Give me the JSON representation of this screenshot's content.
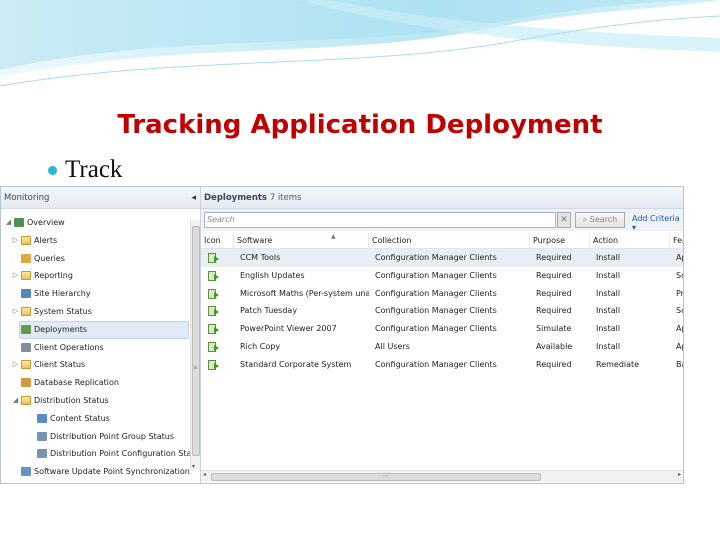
{
  "slide": {
    "title": "Tracking Application Deployment",
    "bullet": "Track"
  },
  "nav": {
    "header": "Monitoring",
    "collapse_glyph": "◂",
    "items": [
      {
        "label": "Overview",
        "icon": "overview-icon",
        "level": 0,
        "twisty": "◢"
      },
      {
        "label": "Alerts",
        "icon": "folder-icon",
        "level": 1,
        "twisty": "▷"
      },
      {
        "label": "Queries",
        "icon": "queries-icon",
        "level": 1,
        "twisty": ""
      },
      {
        "label": "Reporting",
        "icon": "folder-icon",
        "level": 1,
        "twisty": "▷"
      },
      {
        "label": "Site Hierarchy",
        "icon": "site-hierarchy-icon",
        "level": 1,
        "twisty": ""
      },
      {
        "label": "System Status",
        "icon": "folder-icon",
        "level": 1,
        "twisty": "▷"
      },
      {
        "label": "Deployments",
        "icon": "deployments-icon",
        "level": 1,
        "twisty": "",
        "selected": true
      },
      {
        "label": "Client Operations",
        "icon": "client-operations-icon",
        "level": 1,
        "twisty": ""
      },
      {
        "label": "Client Status",
        "icon": "folder-icon",
        "level": 1,
        "twisty": "▷"
      },
      {
        "label": "Database Replication",
        "icon": "database-replication-icon",
        "level": 1,
        "twisty": ""
      },
      {
        "label": "Distribution Status",
        "icon": "folder-icon",
        "level": 1,
        "twisty": "◢"
      },
      {
        "label": "Content Status",
        "icon": "content-status-icon",
        "level": 2,
        "twisty": ""
      },
      {
        "label": "Distribution Point Group Status",
        "icon": "dp-group-status-icon",
        "level": 2,
        "twisty": ""
      },
      {
        "label": "Distribution Point Configuration Status",
        "icon": "dp-config-status-icon",
        "level": 2,
        "twisty": ""
      },
      {
        "label": "Software Update Point Synchronization Sta",
        "icon": "sup-sync-icon",
        "level": 1,
        "twisty": ""
      }
    ]
  },
  "content": {
    "title": "Deployments",
    "count": "7 items",
    "search_placeholder": "Search",
    "clear_glyph": "✕",
    "search_button": "Search",
    "add_criteria": "Add Criteria ▾",
    "columns": [
      "Icon",
      "Software",
      "Collection",
      "Purpose",
      "Action",
      "Fea"
    ],
    "rows": [
      {
        "software": "CCM Tools",
        "collection": "Configuration Manager Clients",
        "purpose": "Required",
        "action": "Install",
        "feature": "Ap"
      },
      {
        "software": "English Updates",
        "collection": "Configuration Manager Clients",
        "purpose": "Required",
        "action": "Install",
        "feature": "Sc"
      },
      {
        "software": "Microsoft Maths (Per-system unatten...",
        "collection": "Configuration Manager Clients",
        "purpose": "Required",
        "action": "Install",
        "feature": "Pr"
      },
      {
        "software": "Patch Tuesday",
        "collection": "Configuration Manager Clients",
        "purpose": "Required",
        "action": "Install",
        "feature": "Sc"
      },
      {
        "software": "PowerPoint Viewer 2007",
        "collection": "Configuration Manager Clients",
        "purpose": "Simulate",
        "action": "Install",
        "feature": "Ap"
      },
      {
        "software": "Rich Copy",
        "collection": "All Users",
        "purpose": "Available",
        "action": "Install",
        "feature": "Ap"
      },
      {
        "software": "Standard Corporate System",
        "collection": "Configuration Manager Clients",
        "purpose": "Required",
        "action": "Remediate",
        "feature": "Ba"
      }
    ]
  },
  "colors": {
    "title_red": "#c00000",
    "bullet_cyan": "#29b6d4",
    "link_blue": "#1d57a5"
  }
}
